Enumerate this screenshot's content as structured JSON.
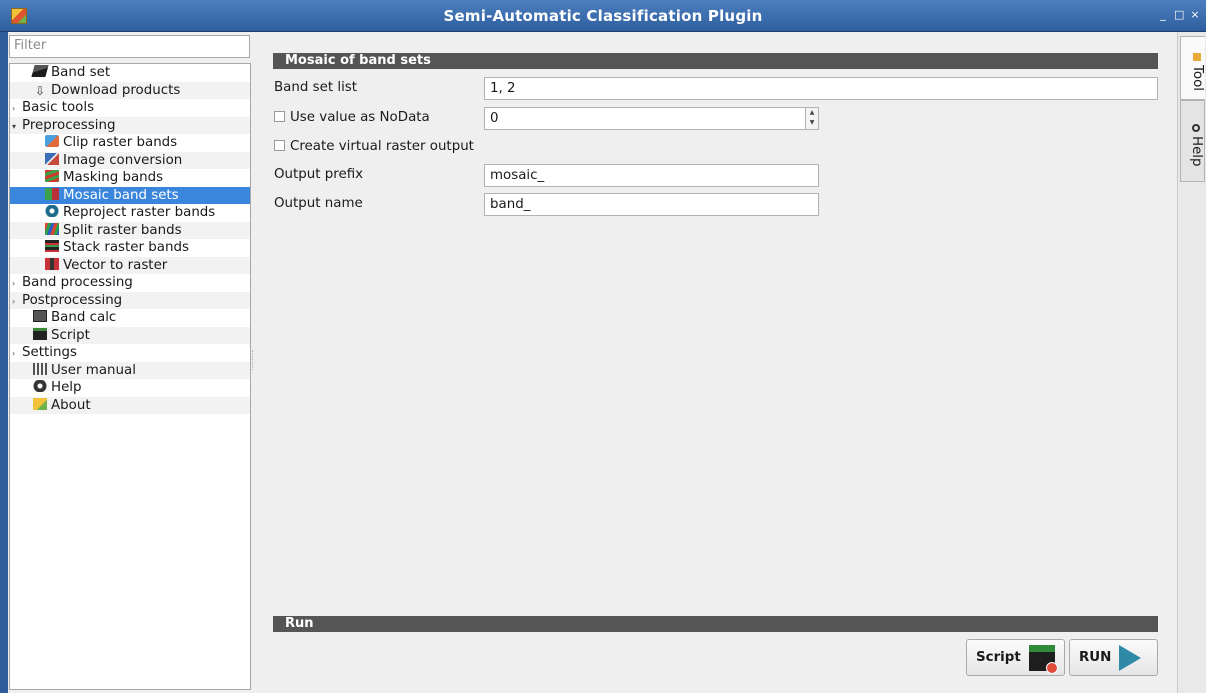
{
  "window": {
    "title": "Semi-Automatic Classification Plugin",
    "controls": [
      "_",
      "□",
      "×"
    ]
  },
  "sidebar": {
    "filter_placeholder": "Filter",
    "items": [
      {
        "label": "Band set",
        "level": 0,
        "icon": "band-set-icon"
      },
      {
        "label": "Download products",
        "level": 0,
        "icon": "download-icon"
      },
      {
        "label": "Basic tools",
        "level": 0,
        "arrow": "›",
        "icon": null
      },
      {
        "label": "Preprocessing",
        "level": 0,
        "arrow": "▾",
        "icon": null
      },
      {
        "label": "Clip raster bands",
        "level": 1,
        "icon": "clip-icon"
      },
      {
        "label": "Image conversion",
        "level": 1,
        "icon": "image-conversion-icon"
      },
      {
        "label": "Masking bands",
        "level": 1,
        "icon": "masking-icon"
      },
      {
        "label": "Mosaic band sets",
        "level": 1,
        "icon": "mosaic-icon",
        "selected": true
      },
      {
        "label": "Reproject raster bands",
        "level": 1,
        "icon": "reproject-icon"
      },
      {
        "label": "Split raster bands",
        "level": 1,
        "icon": "split-icon"
      },
      {
        "label": "Stack raster bands",
        "level": 1,
        "icon": "stack-icon"
      },
      {
        "label": "Vector to raster",
        "level": 1,
        "icon": "vector-to-raster-icon"
      },
      {
        "label": "Band processing",
        "level": 0,
        "arrow": "›",
        "icon": null
      },
      {
        "label": "Postprocessing",
        "level": 0,
        "arrow": "›",
        "icon": null
      },
      {
        "label": "Band calc",
        "level": 0,
        "icon": "band-calc-icon"
      },
      {
        "label": "Script",
        "level": 0,
        "icon": "script-icon"
      },
      {
        "label": "Settings",
        "level": 0,
        "arrow": "›",
        "icon": null
      },
      {
        "label": "User manual",
        "level": 0,
        "icon": "user-manual-icon"
      },
      {
        "label": "Help",
        "level": 0,
        "icon": "help-icon"
      },
      {
        "label": "About",
        "level": 0,
        "icon": "about-icon"
      }
    ]
  },
  "main": {
    "section_title": "Mosaic of band sets",
    "band_set_list_label": "Band set list",
    "band_set_list_value": "1, 2",
    "nodata_checkbox_label": "Use value as NoData",
    "nodata_value": "0",
    "virtual_raster_label": "Create virtual raster output",
    "output_prefix_label": "Output prefix",
    "output_prefix_value": "mosaic_",
    "output_name_label": "Output name",
    "output_name_value": "band_",
    "run_section_title": "Run",
    "script_button": "Script",
    "run_button": "RUN"
  },
  "right_tabs": {
    "tool": "Tool",
    "help": "Help"
  }
}
